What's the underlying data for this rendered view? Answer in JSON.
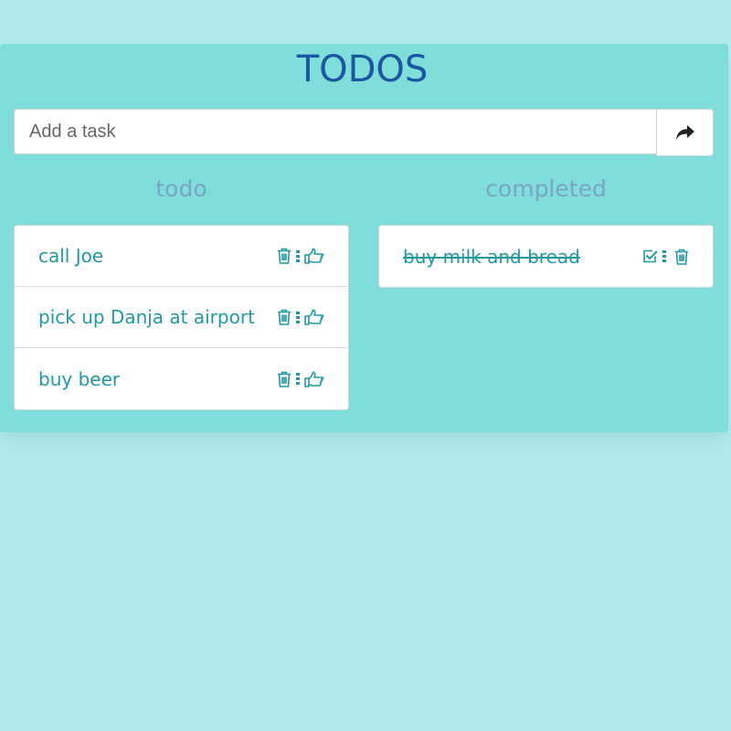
{
  "header": {
    "title": "TODOS"
  },
  "add_task": {
    "placeholder": "Add a task",
    "submit_icon": "share-arrow-icon"
  },
  "todo_column": {
    "heading": "todo",
    "items": [
      {
        "label": "call Joe"
      },
      {
        "label": "pick up Danja at airport"
      },
      {
        "label": "buy beer"
      }
    ]
  },
  "completed_column": {
    "heading": "completed",
    "items": [
      {
        "label": "buy milk and bread"
      }
    ]
  },
  "colors": {
    "page_background": "#b0ecee",
    "panel_background": "#7fded9",
    "title": "#1b56a0",
    "column_heading": "#7ba4c7",
    "item_text": "#1f9aa0"
  }
}
